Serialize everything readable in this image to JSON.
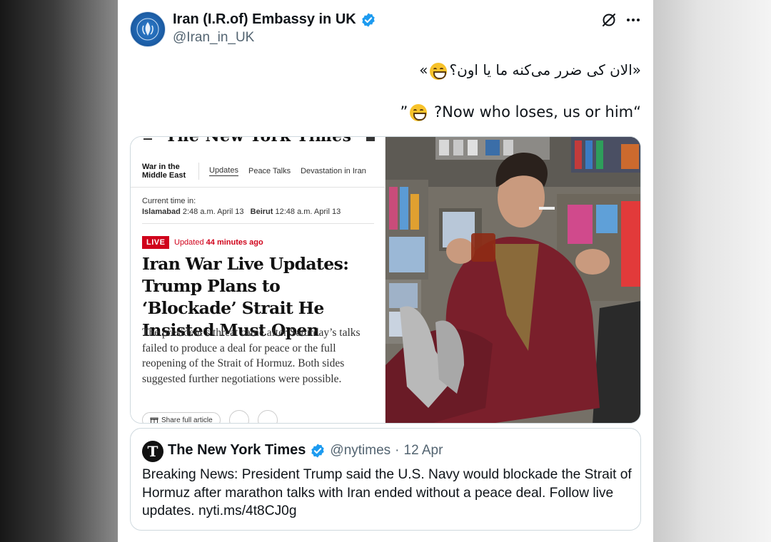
{
  "colors": {
    "accent": "#1d9bf0",
    "text": "#0f1419",
    "muted": "#536471",
    "border": "#cfd9de",
    "nyt_live": "#d0021b"
  },
  "tweet": {
    "display_name": "Iran (I.R.of) Embassy in UK",
    "handle": "@Iran_in_UK",
    "text_persian": "«الان کی ضرر می‌کنه ما یا اون؟",
    "text_persian_close": "»",
    "text_english": "“Now who loses, us or him? ",
    "text_english_close": "”",
    "emoji": "grinning-face-with-smiling-eyes"
  },
  "nyt_screenshot": {
    "masthead": "The New York Times",
    "section": "War in the Middle East",
    "tabs": [
      "Updates",
      "Peace Talks",
      "Devastation in Iran"
    ],
    "current_time_label": "Current time in:",
    "city1": "Islamabad",
    "time1": "2:48 a.m. April 13",
    "city2": "Beirut",
    "time2": "12:48 a.m. April 13",
    "live_badge": "LIVE",
    "updated_prefix": "Updated",
    "updated_ago": "44 minutes ago",
    "headline": "Iran War Live Updates: Trump Plans to ‘Blockade’ Strait He Insisted Must Open",
    "summary": "The president’s threat came after Saturday’s talks failed to produce a deal for peace or the full reopening of the Strait of Hormuz. Both sides suggested further negotiations were possible.",
    "share_label": "Share full article"
  },
  "quoted_tweet": {
    "avatar_letter": "T",
    "display_name": "The New York Times",
    "handle": "@nytimes",
    "separator": "·",
    "date": "12 Apr",
    "text": "Breaking News: President Trump said the U.S. Navy would blockade the Strait of Hormuz after marathon talks with Iran ended without a peace deal. Follow live updates. nyti.ms/4t8CJ0g"
  }
}
